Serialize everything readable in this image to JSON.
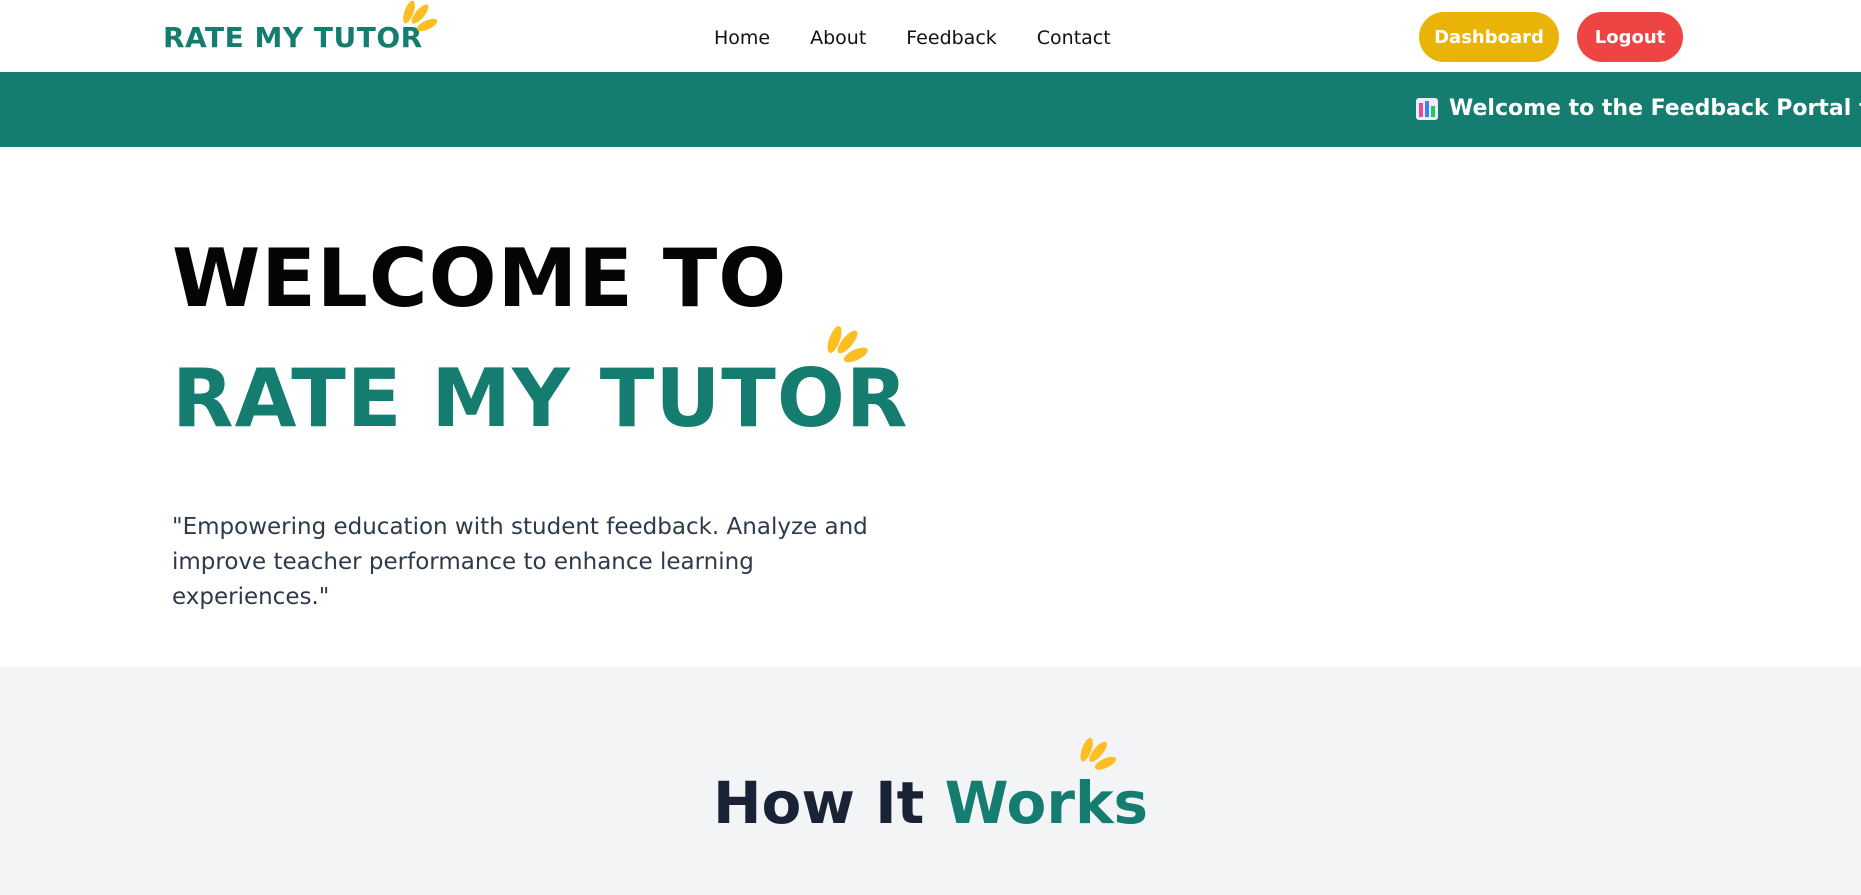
{
  "header": {
    "logo_text": "RATE MY TUTOR",
    "nav": [
      {
        "label": "Home"
      },
      {
        "label": "About"
      },
      {
        "label": "Feedback"
      },
      {
        "label": "Contact"
      }
    ],
    "dashboard_label": "Dashboard",
    "logout_label": "Logout"
  },
  "banner": {
    "icon": "bar-chart-icon",
    "text": "Welcome to the Feedback Portal for Edu"
  },
  "hero": {
    "title_line1": "WELCOME TO",
    "title_line2": "RATE MY TUTOR",
    "quote": "\"Empowering education with student feedback. Analyze and improve teacher performance to enhance learning experiences.\""
  },
  "how_it_works": {
    "title_part1": "How It",
    "title_part2": "Works"
  },
  "colors": {
    "brand_teal": "#147d6f",
    "dashboard_yellow": "#eab308",
    "logout_red": "#ef4444",
    "spark_yellow": "#fbbf24",
    "section_gray": "#f2f4f6"
  }
}
